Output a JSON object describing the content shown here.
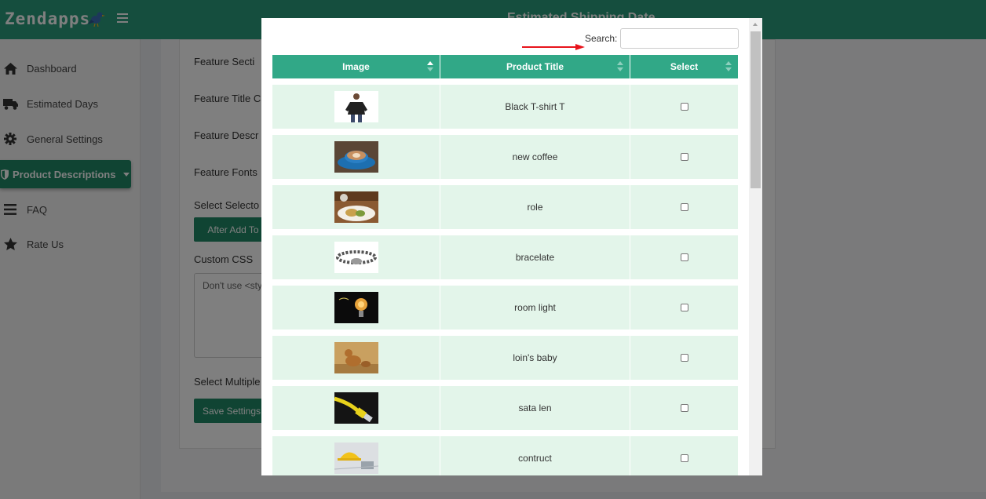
{
  "app": {
    "logo": "Zendapps",
    "title": "Estimated Shipping Date"
  },
  "sidebar": {
    "items": [
      {
        "label": "Dashboard",
        "icon": "home-icon"
      },
      {
        "label": "Estimated Days",
        "icon": "truck-icon"
      },
      {
        "label": "General Settings",
        "icon": "gear-icon"
      },
      {
        "label": "Product Descriptions",
        "icon": "shield-icon",
        "active": true
      },
      {
        "label": "FAQ",
        "icon": "list-icon"
      },
      {
        "label": "Rate Us",
        "icon": "star-icon"
      }
    ]
  },
  "form": {
    "feature_section": "Feature Secti",
    "feature_title": "Feature Title C",
    "feature_description": "Feature Descr",
    "feature_font": "Feature Fonts",
    "select_selector": "Select Selecto",
    "after_add_button": "After Add To",
    "custom_css": "Custom CSS",
    "css_placeholder": "Don't use <sty",
    "select_multiple": "Select Multiple",
    "save_button": "Save Settings"
  },
  "modal": {
    "search_label": "Search:",
    "search_value": "",
    "columns": [
      "Image",
      "Product Title",
      "Select"
    ],
    "rows": [
      {
        "title": "Black T-shirt T",
        "image": "woman-tshirt-image",
        "checked": false
      },
      {
        "title": "new coffee",
        "image": "coffee-cup-image",
        "checked": false
      },
      {
        "title": "role",
        "image": "food-plate-image",
        "checked": false
      },
      {
        "title": "bracelate",
        "image": "bracelet-image",
        "checked": false
      },
      {
        "title": "room light",
        "image": "light-bulb-image",
        "checked": false
      },
      {
        "title": "loin's baby",
        "image": "lion-cub-image",
        "checked": false
      },
      {
        "title": "sata len",
        "image": "network-cable-image",
        "checked": false
      },
      {
        "title": "contruct",
        "image": "hard-hat-image",
        "checked": false
      }
    ]
  },
  "colors": {
    "brand": "#2b9d7c",
    "header": "#31a887",
    "row_bg": "#e3f5ea",
    "annotation_arrow": "#e8141c"
  }
}
